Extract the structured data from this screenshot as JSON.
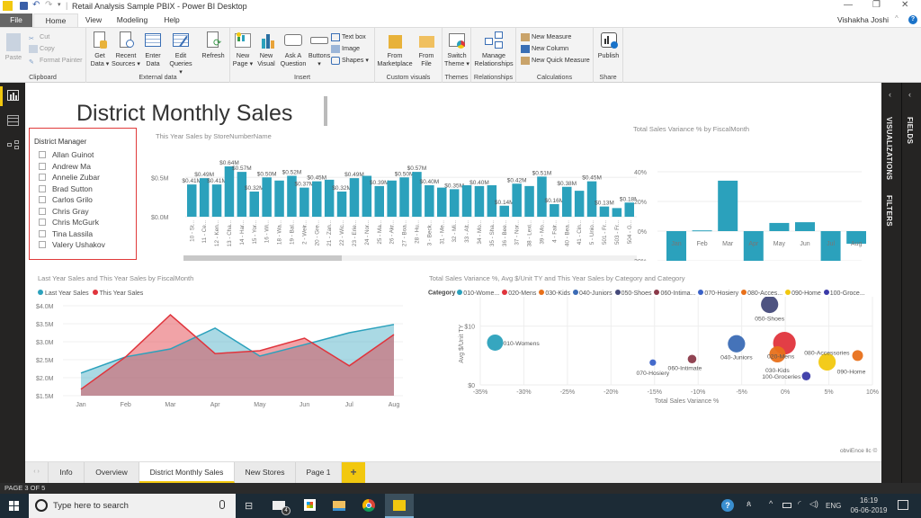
{
  "window": {
    "title": "Retail Analysis Sample PBIX - Power BI Desktop",
    "user": "Vishakha Joshi"
  },
  "ribbon_tabs": [
    "File",
    "Home",
    "View",
    "Modeling",
    "Help"
  ],
  "ribbon": {
    "clipboard": {
      "paste": "Paste",
      "cut": "Cut",
      "copy": "Copy",
      "format_painter": "Format Painter",
      "label": "Clipboard"
    },
    "external_data": {
      "get_data": [
        "Get",
        "Data ▾"
      ],
      "recent_sources": [
        "Recent",
        "Sources ▾"
      ],
      "enter_data": [
        "Enter",
        "Data"
      ],
      "edit_queries": [
        "Edit",
        "Queries ▾"
      ],
      "refresh": "Refresh",
      "label": "External data"
    },
    "insert": {
      "new_page": [
        "New",
        "Page ▾"
      ],
      "new_visual": [
        "New",
        "Visual"
      ],
      "ask_question": [
        "Ask A",
        "Question"
      ],
      "buttons": [
        "Buttons",
        "▾"
      ],
      "text_box": "Text box",
      "image": "Image",
      "shapes": "Shapes ▾",
      "label": "Insert"
    },
    "custom_visuals": {
      "from_marketplace": [
        "From",
        "Marketplace"
      ],
      "from_file": [
        "From",
        "File"
      ],
      "label": "Custom visuals"
    },
    "themes": {
      "switch_theme": [
        "Switch",
        "Theme ▾"
      ],
      "label": "Themes"
    },
    "relationships": {
      "manage": [
        "Manage",
        "Relationships"
      ],
      "label": "Relationships"
    },
    "calculations": {
      "new_measure": "New Measure",
      "new_column": "New Column",
      "new_quick_measure": "New Quick Measure",
      "label": "Calculations"
    },
    "share": {
      "publish": "Publish",
      "label": "Share"
    }
  },
  "right_panes": {
    "visualizations": "VISUALIZATIONS",
    "filters": "FILTERS",
    "fields": "FIELDS"
  },
  "report": {
    "title": "District Monthly Sales",
    "slicer": {
      "title": "District Manager",
      "items": [
        "Allan Guinot",
        "Andrew Ma",
        "Annelie Zubar",
        "Brad Sutton",
        "Carlos Grilo",
        "Chris Gray",
        "Chris McGurk",
        "Tina Lassila",
        "Valery Ushakov"
      ]
    },
    "footer": "obviEnce llc ©"
  },
  "chart_data": [
    {
      "type": "bar",
      "title": "This Year Sales by StoreNumberName",
      "categories": [
        "10 - St...",
        "11 - Ce...",
        "12 - Ken...",
        "13 - Cha...",
        "14 - Har...",
        "15 - Yor...",
        "16 - Wi...",
        "18 - Wa...",
        "19 - Bal...",
        "2 - Weir...",
        "20 - Gre...",
        "21 - Zan...",
        "22 - Wic...",
        "23 - Erie...",
        "24 - Nor...",
        "25 - Ma...",
        "26 - Akr...",
        "27 - Boa...",
        "28 - Hu...",
        "3 - Beck...",
        "31 - Me...",
        "32 - Mi...",
        "33 - Alt...",
        "34 - Mo...",
        "35 - Sha...",
        "36 - Bee...",
        "37 - Nor...",
        "38 - Lexi...",
        "39 - Mo...",
        "4 - Fair...",
        "40 - Bea...",
        "41 - Cin...",
        "5 - Unio...",
        "501 - Fr...",
        "503 - Fr...",
        "504 - G..."
      ],
      "values": [
        0.41,
        0.49,
        0.41,
        0.64,
        0.57,
        0.32,
        0.5,
        0.46,
        0.52,
        0.37,
        0.45,
        0.47,
        0.32,
        0.49,
        0.52,
        0.39,
        0.46,
        0.5,
        0.57,
        0.4,
        0.37,
        0.35,
        0.4,
        0.39,
        0.4,
        0.14,
        0.42,
        0.39,
        0.51,
        0.16,
        0.38,
        0.33,
        0.45,
        0.13,
        0.11,
        0.18
      ],
      "data_labels": [
        "$0.41M",
        "$0.49M",
        "$0.41M",
        "$0.64M",
        "$0.57M",
        "$0.32M",
        "$0.50M",
        "",
        "$0.52M",
        "$0.37M",
        "$0.45M",
        "",
        "$0.32M",
        "$0.49M",
        "",
        "$0.39M",
        "",
        "$0.50M",
        "$0.57M",
        "$0.40M",
        "",
        "$0.35M",
        "",
        "$0.40M",
        "",
        "$0.14M",
        "$0.42M",
        "",
        "$0.51M",
        "$0.16M",
        "$0.38M",
        "",
        "$0.45M",
        "$0.13M",
        "",
        "$0.18M"
      ],
      "y_ticks": [
        "$0.0M",
        "$0.5M"
      ],
      "ylim": [
        0,
        0.7
      ],
      "unit": "$M",
      "color": "#2ba1bc"
    },
    {
      "type": "bar",
      "title": "Total Sales Variance % by FiscalMonth",
      "categories": [
        "Jan",
        "Feb",
        "Mar",
        "Apr",
        "May",
        "Jun",
        "Jul",
        "Aug"
      ],
      "values": [
        -21.5,
        0.5,
        34,
        -21.5,
        5.5,
        6,
        -28,
        -8.5
      ],
      "y_ticks": [
        "-20%",
        "0%",
        "20%",
        "40%"
      ],
      "ylim": [
        -30,
        40
      ],
      "unit": "%",
      "color": "#2ba1bc"
    },
    {
      "type": "area",
      "title": "Last Year Sales and This Year Sales by FiscalMonth",
      "categories": [
        "Jan",
        "Feb",
        "Mar",
        "Apr",
        "May",
        "Jun",
        "Jul",
        "Aug"
      ],
      "series": [
        {
          "name": "Last Year Sales",
          "values": [
            2.13,
            2.58,
            2.8,
            3.38,
            2.6,
            2.92,
            3.25,
            3.48
          ],
          "color": "#2ba1bc"
        },
        {
          "name": "This Year Sales",
          "values": [
            1.68,
            2.58,
            3.75,
            2.67,
            2.75,
            3.1,
            2.33,
            3.2
          ],
          "color": "#e0343c"
        }
      ],
      "y_ticks": [
        "$1.5M",
        "$2.0M",
        "$2.5M",
        "$3.0M",
        "$3.5M",
        "$4.0M"
      ],
      "ylim": [
        1.5,
        4.0
      ],
      "unit": "$M",
      "legend": "top-left"
    },
    {
      "type": "scatter",
      "title": "Total Sales Variance %, Avg $/Unit TY and This Year Sales by Category and Category",
      "legend_title": "Category",
      "legend": [
        {
          "name": "010-Wome...",
          "color": "#2ba1bc"
        },
        {
          "name": "020-Mens",
          "color": "#e0343c"
        },
        {
          "name": "030-Kids",
          "color": "#e8701a"
        },
        {
          "name": "040-Juniors",
          "color": "#3b6bb5"
        },
        {
          "name": "050-Shoes",
          "color": "#454a7a"
        },
        {
          "name": "060-Intima...",
          "color": "#8b3a4a"
        },
        {
          "name": "070-Hosiery",
          "color": "#3a62c8"
        },
        {
          "name": "080-Acces...",
          "color": "#e8701a"
        },
        {
          "name": "090-Home",
          "color": "#f2c80f"
        },
        {
          "name": "100-Groce...",
          "color": "#3a3aa8"
        }
      ],
      "points": [
        {
          "label": "010-Womens",
          "x": -33.3,
          "y": 7.2,
          "size": 3.0,
          "color": "#2ba1bc"
        },
        {
          "label": "020-Mens",
          "x": -0.1,
          "y": 7.1,
          "size": 4.2,
          "color": "#e0343c"
        },
        {
          "label": "030-Kids",
          "x": -0.9,
          "y": 5.2,
          "size": 3.0,
          "color": "#e8701a"
        },
        {
          "label": "040-Juniors",
          "x": -5.6,
          "y": 7.0,
          "size": 3.2,
          "color": "#3b6bb5"
        },
        {
          "label": "050-Shoes",
          "x": -1.8,
          "y": 13.7,
          "size": 3.2,
          "color": "#454a7a"
        },
        {
          "label": "060-Intimate",
          "x": -10.7,
          "y": 4.4,
          "size": 1.6,
          "color": "#8b3a4a"
        },
        {
          "label": "070-Hosiery",
          "x": -15.2,
          "y": 3.8,
          "size": 1.2,
          "color": "#3a62c8"
        },
        {
          "label": "080-Accessories",
          "x": 8.3,
          "y": 5.0,
          "size": 2.0,
          "color": "#e8701a"
        },
        {
          "label": "090-Home",
          "x": 4.8,
          "y": 3.9,
          "size": 3.2,
          "color": "#f2c80f"
        },
        {
          "label": "100-Groceries",
          "x": 2.4,
          "y": 1.5,
          "size": 1.6,
          "color": "#3a3aa8"
        }
      ],
      "x_ticks": [
        "-35%",
        "-30%",
        "-25%",
        "-20%",
        "-15%",
        "-10%",
        "-5%",
        "0%",
        "5%",
        "10%"
      ],
      "xlim": [
        -35,
        10
      ],
      "y_ticks": [
        "$0",
        "$10"
      ],
      "ylim": [
        0,
        15
      ],
      "xlabel": "Total Sales Variance %",
      "ylabel": "Avg $/Unit TY"
    }
  ],
  "page_tabs": [
    "Info",
    "Overview",
    "District Monthly Sales",
    "New Stores",
    "Page 1"
  ],
  "active_page_tab": "District Monthly Sales",
  "status": "PAGE 3 OF 5",
  "taskbar": {
    "search_placeholder": "Type here to search",
    "mail_badge": "4",
    "language": "ENG",
    "time": "16:19",
    "date": "06-06-2019"
  },
  "colors": {
    "accent": "#f2c80f",
    "teal": "#2ba1bc",
    "red": "#e0343c",
    "slicer_border": "#e03a3a"
  }
}
